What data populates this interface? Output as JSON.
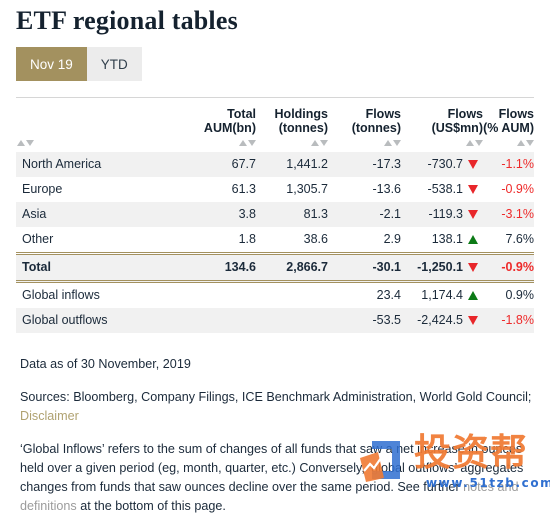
{
  "header": {
    "title": "ETF regional tables"
  },
  "tabs": [
    {
      "label": "Nov 19",
      "active": true
    },
    {
      "label": "YTD",
      "active": false
    }
  ],
  "table": {
    "columns": [
      {
        "key": "label",
        "line1": "",
        "line2": "",
        "sortable": true
      },
      {
        "key": "aum",
        "line1": "Total",
        "line2": "AUM(bn)",
        "sortable": true
      },
      {
        "key": "hold",
        "line1": "Holdings",
        "line2": "(tonnes)",
        "sortable": true
      },
      {
        "key": "flowt",
        "line1": "Flows",
        "line2": "(tonnes)",
        "sortable": true
      },
      {
        "key": "flowu",
        "line1": "Flows",
        "line2": "(US$mn)",
        "sortable": true
      },
      {
        "key": "pct",
        "line1": "Flows",
        "line2": "(% AUM)",
        "sortable": true
      }
    ],
    "rows": [
      {
        "label": "North America",
        "aum": "67.7",
        "hold": "1,441.2",
        "flowt": "-17.3",
        "flowu": "-730.7",
        "arrow": "down",
        "pct": "-1.1%",
        "pct_negative": true,
        "style": "stripe"
      },
      {
        "label": "Europe",
        "aum": "61.3",
        "hold": "1,305.7",
        "flowt": "-13.6",
        "flowu": "-538.1",
        "arrow": "down",
        "pct": "-0.9%",
        "pct_negative": true,
        "style": "plain"
      },
      {
        "label": "Asia",
        "aum": "3.8",
        "hold": "81.3",
        "flowt": "-2.1",
        "flowu": "-119.3",
        "arrow": "down",
        "pct": "-3.1%",
        "pct_negative": true,
        "style": "stripe"
      },
      {
        "label": "Other",
        "aum": "1.8",
        "hold": "38.6",
        "flowt": "2.9",
        "flowu": "138.1",
        "arrow": "up",
        "pct": "7.6%",
        "pct_negative": false,
        "style": "plain"
      },
      {
        "label": "Total",
        "aum": "134.6",
        "hold": "2,866.7",
        "flowt": "-30.1",
        "flowu": "-1,250.1",
        "arrow": "down",
        "pct": "-0.9%",
        "pct_negative": true,
        "style": "total"
      },
      {
        "label": "Global inflows",
        "aum": "",
        "hold": "",
        "flowt": "23.4",
        "flowu": "1,174.4",
        "arrow": "up",
        "pct": "0.9%",
        "pct_negative": false,
        "style": "plain"
      },
      {
        "label": "Global outflows",
        "aum": "",
        "hold": "",
        "flowt": "-53.5",
        "flowu": "-2,424.5",
        "arrow": "down",
        "pct": "-1.8%",
        "pct_negative": true,
        "style": "stripe"
      }
    ]
  },
  "notes": {
    "data_as_of": "Data as of 30 November, 2019",
    "sources_prefix": "Sources: Bloomberg, Company Filings, ICE Benchmark Administration, World Gold Council;",
    "disclaimer_link": "Disclaimer",
    "definition_part1": "‘Global Inflows’ refers to the sum of changes of all funds that saw a net increase in ounces held over a given period (eg, month, quarter, etc.) Conversely, ‘global outflows’ aggregates changes from funds that saw ounces decline over the same period. See further",
    "definition_link": "notes and definitions",
    "definition_part2": "at the bottom of this page."
  },
  "watermark": {
    "characters": "投资帮",
    "url": "www.51tzb.com",
    "orange": "#f07a33",
    "blue": "#2f6fd0"
  }
}
